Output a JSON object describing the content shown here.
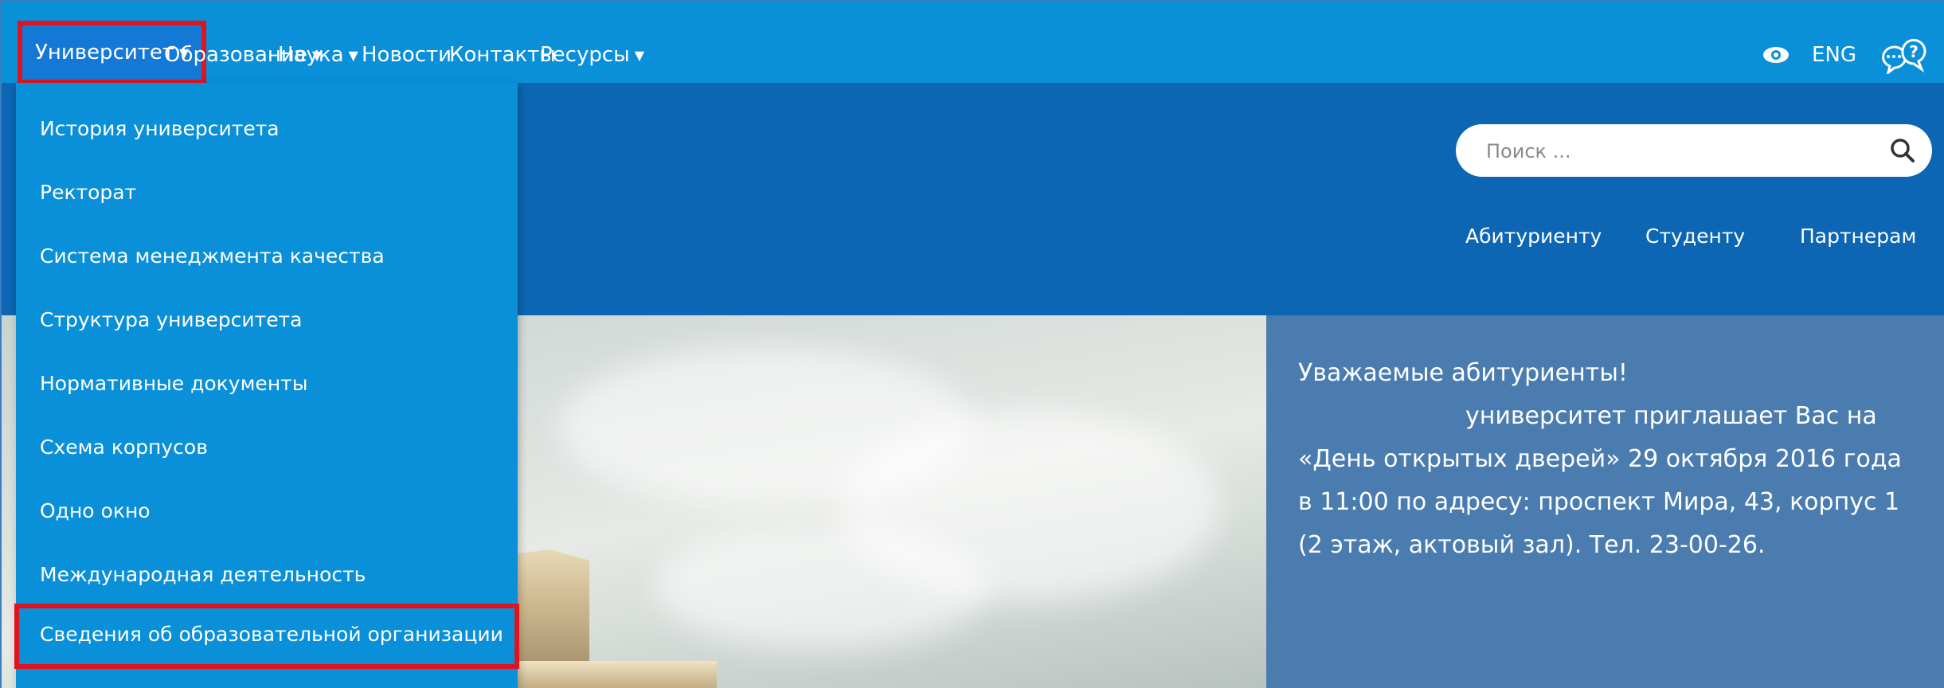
{
  "topnav": {
    "items": [
      {
        "label": "Университет",
        "has_caret": true,
        "active": true
      },
      {
        "label": "Образование",
        "has_caret": true
      },
      {
        "label": "Наука",
        "has_caret": true
      },
      {
        "label": "Новости",
        "has_caret": false
      },
      {
        "label": "Контакты",
        "has_caret": false
      },
      {
        "label": "Ресурсы",
        "has_caret": true
      }
    ],
    "lang_label": "ENG",
    "icons": [
      "eye-icon",
      "help-chat-icon"
    ],
    "highlight_color": "#e0141e",
    "bar_color": "#0a8fd9"
  },
  "dropdown": {
    "items": [
      "История университета",
      "Ректорат",
      "Система менеджмента качества",
      "Структура университета",
      "Нормативные документы",
      "Схема корпусов",
      "Одно окно",
      "Международная деятельность",
      "Сведения об образовательной организации"
    ],
    "highlighted_item": "Сведения об образовательной организации"
  },
  "header": {
    "search": {
      "placeholder": "Поиск ...",
      "value": ""
    },
    "audience_links": [
      "Абитуриенту",
      "Студенту",
      "Партнерам"
    ],
    "band_color": "#0c66b3"
  },
  "announcement": {
    "title": "Уважаемые абитуриенты!",
    "body": "университет приглашает Вас на «День открытых дверей» 29 октября 2016 года в 11:00 по адресу: проспект Мира, 43, корпус 1 (2 этаж, актовый зал). Тел. 23-00-26.",
    "bg_color": "#4a7cb0"
  }
}
